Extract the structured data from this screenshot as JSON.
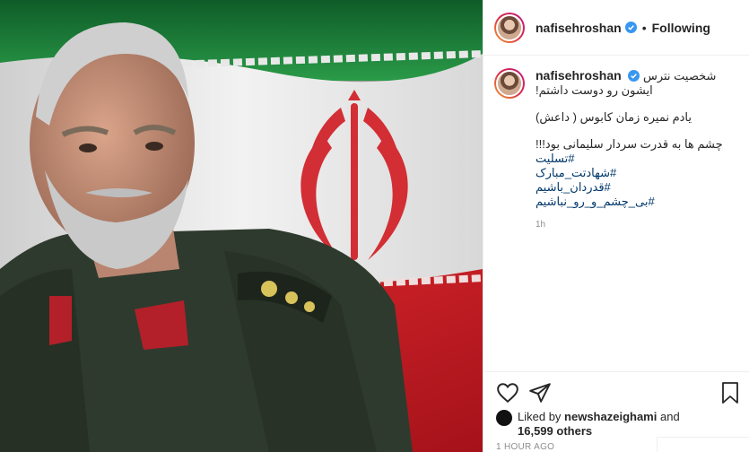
{
  "post": {
    "username": "nafisehroshan",
    "separator": "•",
    "follow_label": "Following"
  },
  "caption": {
    "username": "nafisehroshan",
    "line1": "شخصیت نترس",
    "line2": "ایشون رو دوست داشتم!",
    "line3": "یادم نمیره زمان کابوس ( داعش)",
    "line4": "چشم ها به قدرت سردار سلیمانی بود!!!",
    "hashtags": [
      "#تسلیت",
      "#شهادتت_مبارک",
      "#قدردان_باشیم",
      "#بی_چشم_و_رو_نباشیم"
    ],
    "time": "1h"
  },
  "likes": {
    "prefix": "Liked by",
    "user": "newshazeighami",
    "conjunction": "and",
    "count": "16,599 others"
  },
  "timestamp": "1 HOUR AGO",
  "icons": [
    "heart-icon",
    "share-icon",
    "bookmark-icon",
    "verified-badge-icon"
  ],
  "colors": {
    "verified": "#3897f0",
    "hashtag": "#00376b",
    "flag_green": "#1e8a3a",
    "flag_red": "#d11f26"
  }
}
